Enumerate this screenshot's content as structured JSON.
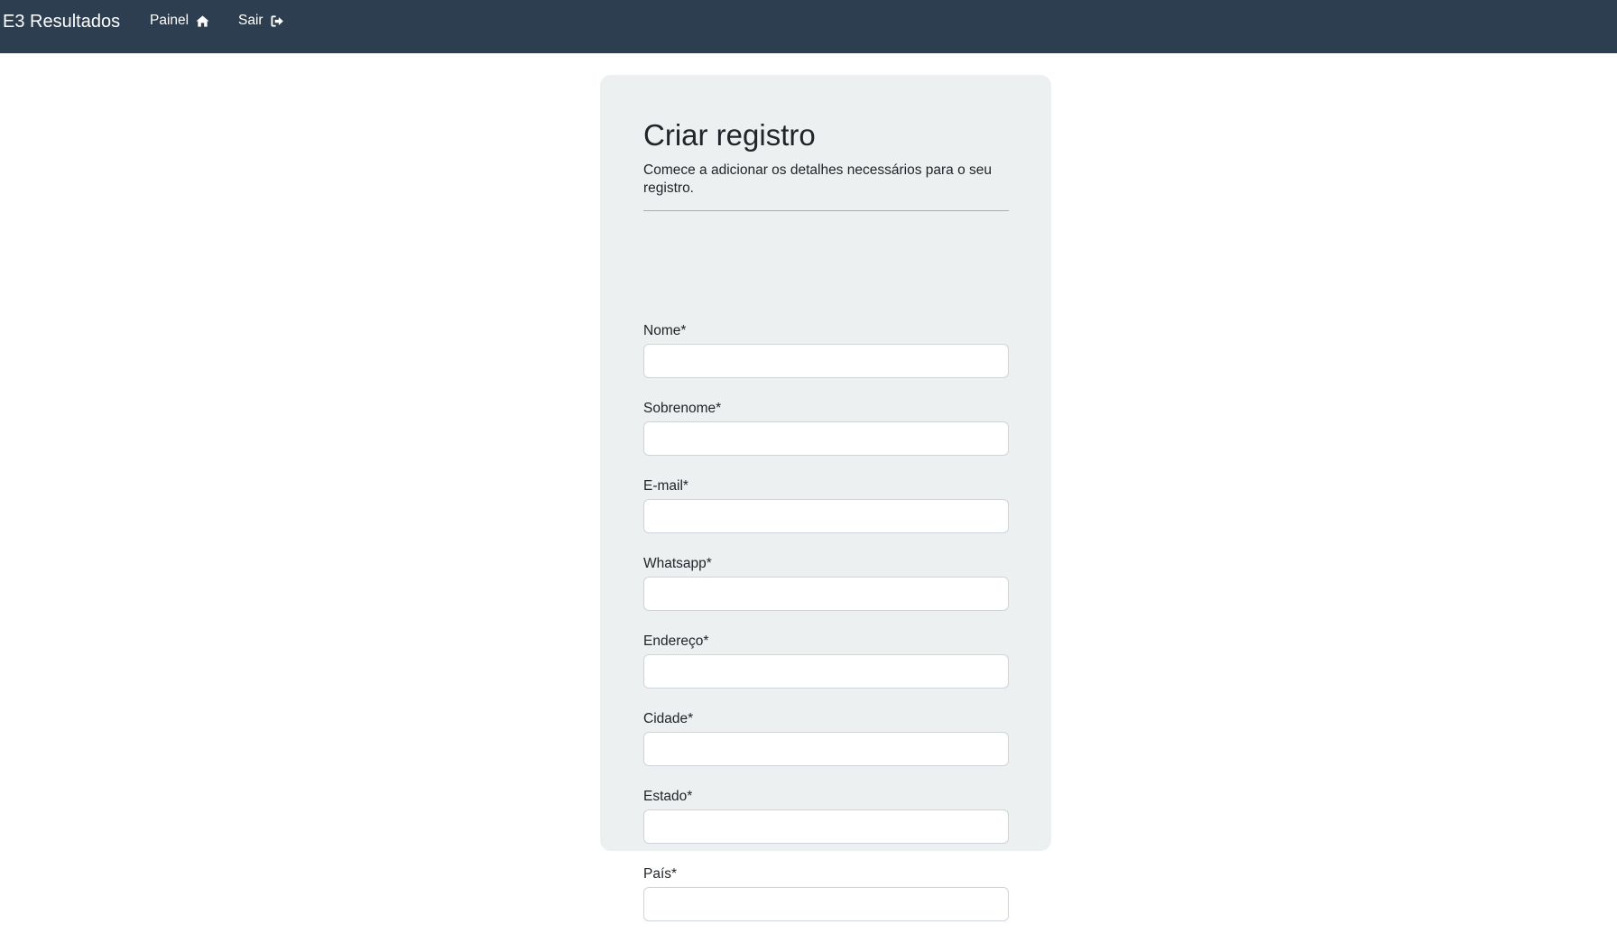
{
  "navbar": {
    "brand": "E3 Resultados",
    "links": [
      {
        "label": "Painel",
        "icon": "home-icon"
      },
      {
        "label": "Sair",
        "icon": "sign-out-icon"
      }
    ]
  },
  "form": {
    "title": "Criar registro",
    "subtitle": "Comece a adicionar os detalhes necessários para o seu registro.",
    "fields": [
      {
        "label": "Nome*",
        "value": "",
        "placeholder": ""
      },
      {
        "label": "Sobrenome*",
        "value": "",
        "placeholder": ""
      },
      {
        "label": "E-mail*",
        "value": "",
        "placeholder": ""
      },
      {
        "label": "Whatsapp*",
        "value": "",
        "placeholder": ""
      },
      {
        "label": "Endereço*",
        "value": "",
        "placeholder": ""
      },
      {
        "label": "Cidade*",
        "value": "",
        "placeholder": ""
      },
      {
        "label": "Estado*",
        "value": "",
        "placeholder": ""
      },
      {
        "label": "País*",
        "value": "",
        "placeholder": ""
      }
    ]
  },
  "colors": {
    "navbar_bg": "#2c3e50",
    "card_bg": "#ecf0f1",
    "input_border": "#ced4da"
  }
}
